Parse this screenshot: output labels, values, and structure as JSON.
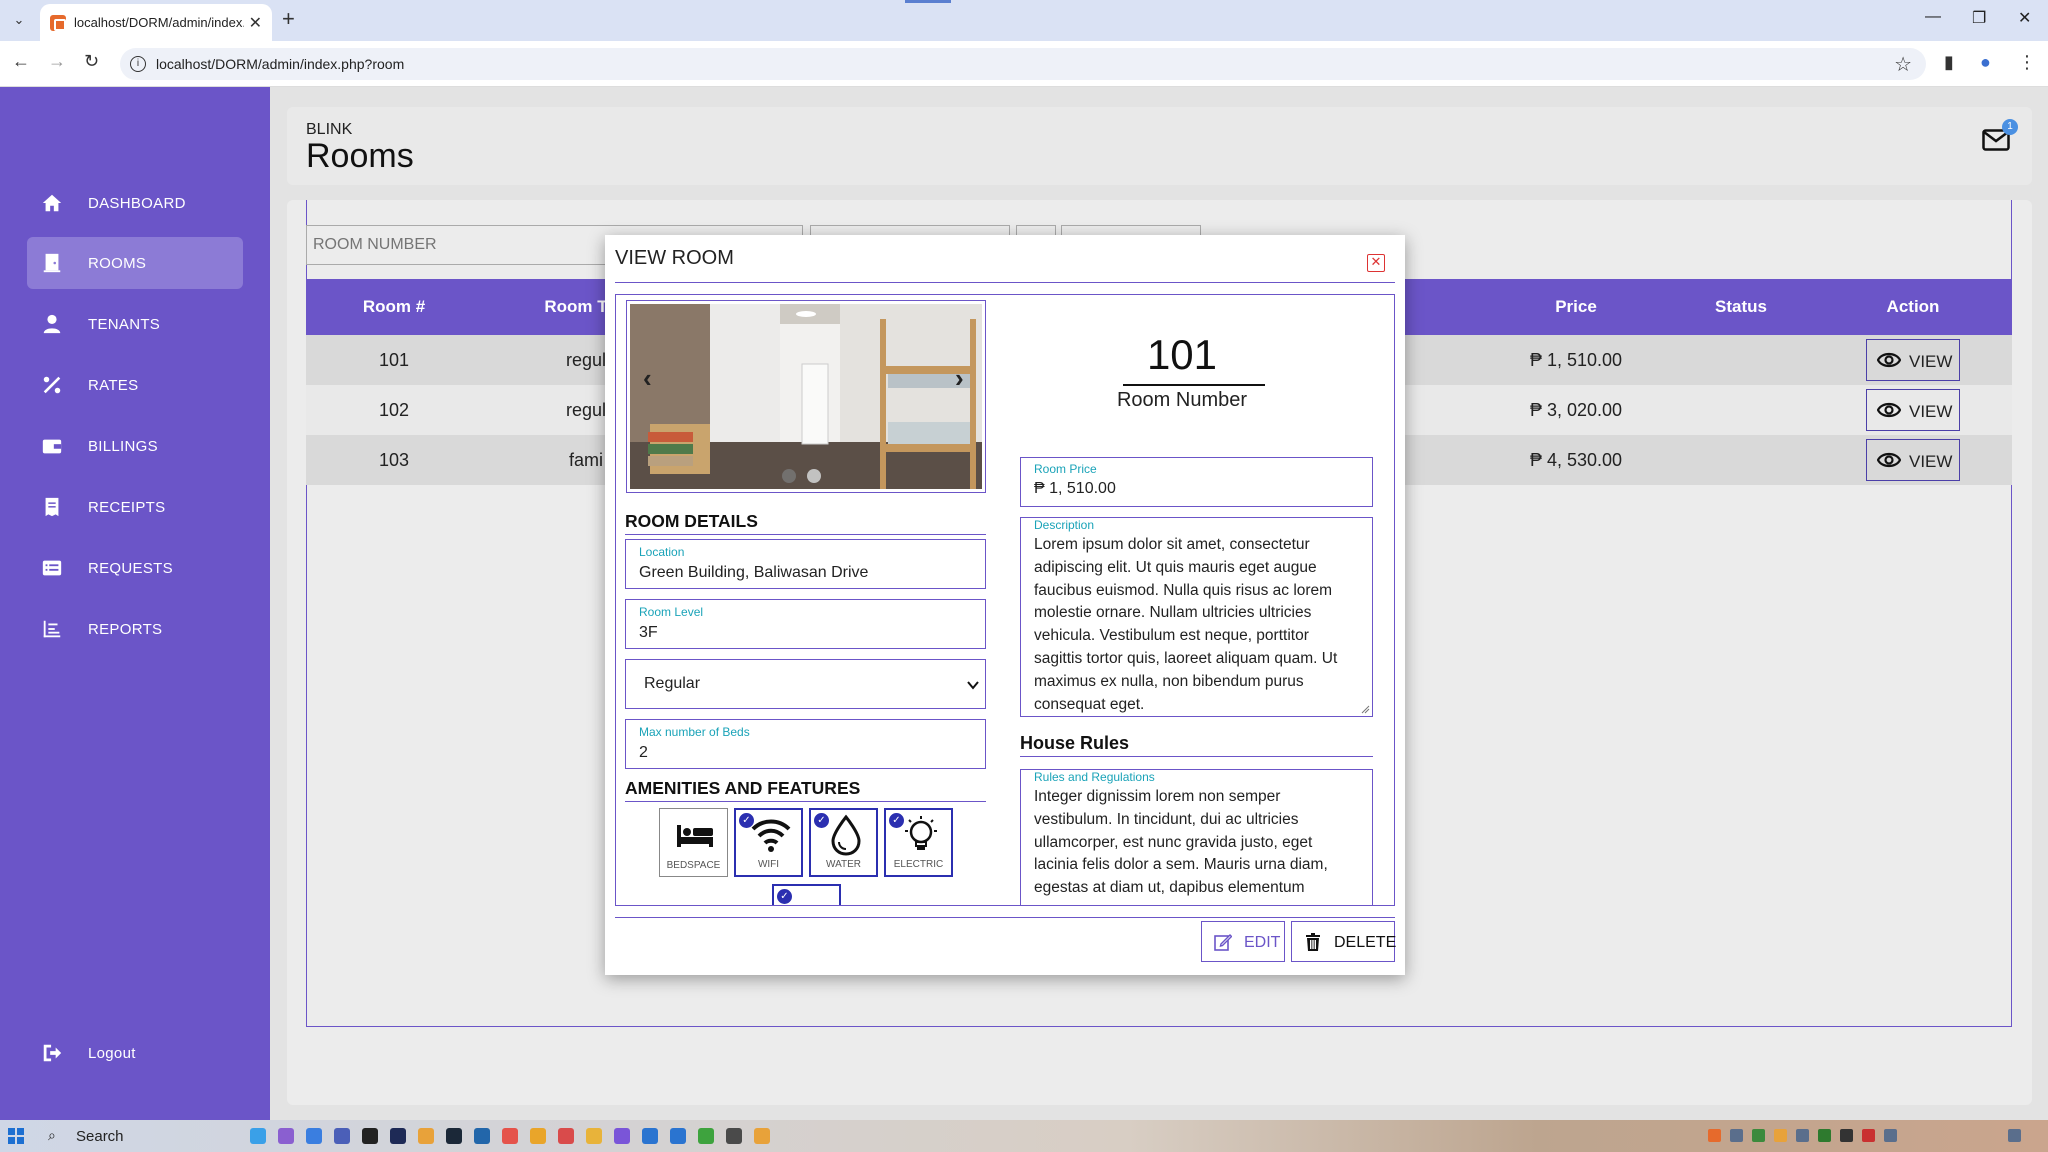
{
  "browser": {
    "tab_title": "localhost/DORM/admin/index.",
    "tab_close": "✕",
    "new_tab": "+",
    "url": "localhost/DORM/admin/index.php?room",
    "minimize": "—",
    "restore": "❐",
    "close": "✕"
  },
  "sidebar": {
    "items": [
      {
        "label": "DASHBOARD",
        "icon": "home-icon"
      },
      {
        "label": "ROOMS",
        "icon": "door-icon"
      },
      {
        "label": "TENANTS",
        "icon": "user-icon"
      },
      {
        "label": "RATES",
        "icon": "percent-icon"
      },
      {
        "label": "BILLINGS",
        "icon": "wallet-icon"
      },
      {
        "label": "RECEIPTS",
        "icon": "receipt-icon"
      },
      {
        "label": "REQUESTS",
        "icon": "list-icon"
      },
      {
        "label": "REPORTS",
        "icon": "chart-icon"
      }
    ],
    "logout": "Logout"
  },
  "header": {
    "subtitle": "BLINK",
    "title": "Rooms",
    "notification_count": "1"
  },
  "filters": {
    "search_placeholder": "ROOM NUMBER"
  },
  "table": {
    "columns": [
      "Room #",
      "Room T",
      "Price",
      "Status",
      "Action"
    ],
    "rows": [
      {
        "room": "101",
        "type": "regul",
        "price": "₱ 1, 510.00",
        "status": "",
        "action": "VIEW"
      },
      {
        "room": "102",
        "type": "regul",
        "price": "₱ 3, 020.00",
        "status": "",
        "action": "VIEW"
      },
      {
        "room": "103",
        "type": "fami",
        "price": "₱ 4, 530.00",
        "status": "",
        "action": "VIEW"
      }
    ]
  },
  "modal": {
    "title": "VIEW ROOM",
    "close_icon": "✕",
    "carousel": {
      "prev": "‹",
      "next": "›",
      "slides": 2,
      "active": 1
    },
    "room_number": "101",
    "room_number_label": "Room Number",
    "room_details_heading": "ROOM DETAILS",
    "location": {
      "label": "Location",
      "value": "Green Building, Baliwasan Drive"
    },
    "room_level": {
      "label": "Room Level",
      "value": "3F"
    },
    "room_type": {
      "value": "Regular"
    },
    "max_beds": {
      "label": "Max number of Beds",
      "value": "2"
    },
    "amenities_heading": "AMENITIES AND FEATURES",
    "amenities": [
      {
        "label": "BEDSPACE",
        "icon": "bed-icon",
        "checked": false
      },
      {
        "label": "WIFI",
        "icon": "wifi-icon",
        "checked": true
      },
      {
        "label": "WATER",
        "icon": "water-drop-icon",
        "checked": true
      },
      {
        "label": "ELECTRIC",
        "icon": "lightbulb-icon",
        "checked": true
      }
    ],
    "room_price": {
      "label": "Room Price",
      "value": "₱ 1, 510.00"
    },
    "description": {
      "label": "Description",
      "value": "Lorem ipsum dolor sit amet, consectetur adipiscing elit. Ut quis mauris eget augue faucibus euismod. Nulla quis risus ac lorem molestie ornare. Nullam ultricies ultricies vehicula. Vestibulum est neque, porttitor sagittis tortor quis, laoreet aliquam quam. Ut maximus ex nulla, non bibendum purus consequat eget."
    },
    "house_rules_heading": "House Rules",
    "rules": {
      "label": "Rules and Regulations",
      "value": "Integer dignissim lorem non semper vestibulum. In tincidunt, dui ac ultricies ullamcorper, est nunc gravida justo, eget lacinia felis dolor a sem. Mauris urna diam, egestas at diam ut, dapibus elementum"
    },
    "edit_label": "EDIT",
    "delete_label": "DELETE"
  },
  "taskbar": {
    "search_label": "Search"
  },
  "colors": {
    "sidebar": "#6b55c8",
    "accent": "#6b55c8",
    "label_teal": "#1aa3b8",
    "checked_blue": "#2b2fb0",
    "close_red": "#dd3333"
  }
}
